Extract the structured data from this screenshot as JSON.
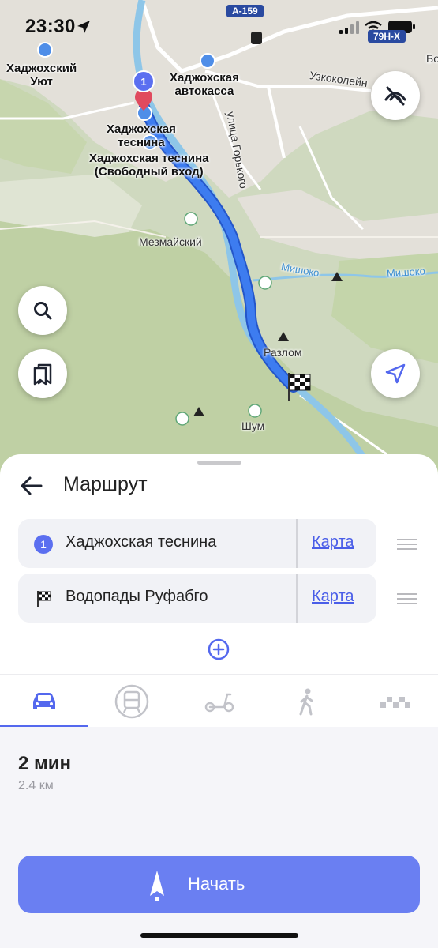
{
  "status_bar": {
    "time": "23:30",
    "road_sign": "79Н-Х"
  },
  "map": {
    "labels": {
      "hadzhokh_uyut": "Хаджохский\nУют",
      "bus_station": "Хаджохская\nавтокасса",
      "gorge": "Хаджохская\nтеснина",
      "gorge_free": "Хаджохская теснина\n(Свободный вход)",
      "mezmaisky": "Мезмайский",
      "razlom": "Разлом",
      "shum": "Шум",
      "gorkogo_street": "улица Горького",
      "narrow_gauge": "Узкоколейн",
      "mishoko_1": "Мишоко",
      "mishoko_2": "Мишоко",
      "bo": "Бо"
    },
    "road_badge": "А-159",
    "route_waypoint_number": "1"
  },
  "sheet": {
    "title": "Маршрут",
    "waypoints": [
      {
        "badge": "1",
        "name": "Хаджохская теснина",
        "map_link": "Карта"
      },
      {
        "badge": "flag",
        "name": "Водопады Руфабго",
        "map_link": "Карта"
      }
    ],
    "transport_tabs": [
      {
        "name": "car",
        "selected": true
      },
      {
        "name": "public-transport",
        "selected": false
      },
      {
        "name": "scooter",
        "selected": false
      },
      {
        "name": "walk",
        "selected": false
      },
      {
        "name": "taxi",
        "selected": false
      }
    ],
    "summary": {
      "duration": "2 мин",
      "distance": "2.4 км"
    },
    "start_label": "Начать"
  },
  "colors": {
    "accent": "#6a7ff2",
    "route": "#3d7cf0",
    "link": "#4a5ee8"
  }
}
